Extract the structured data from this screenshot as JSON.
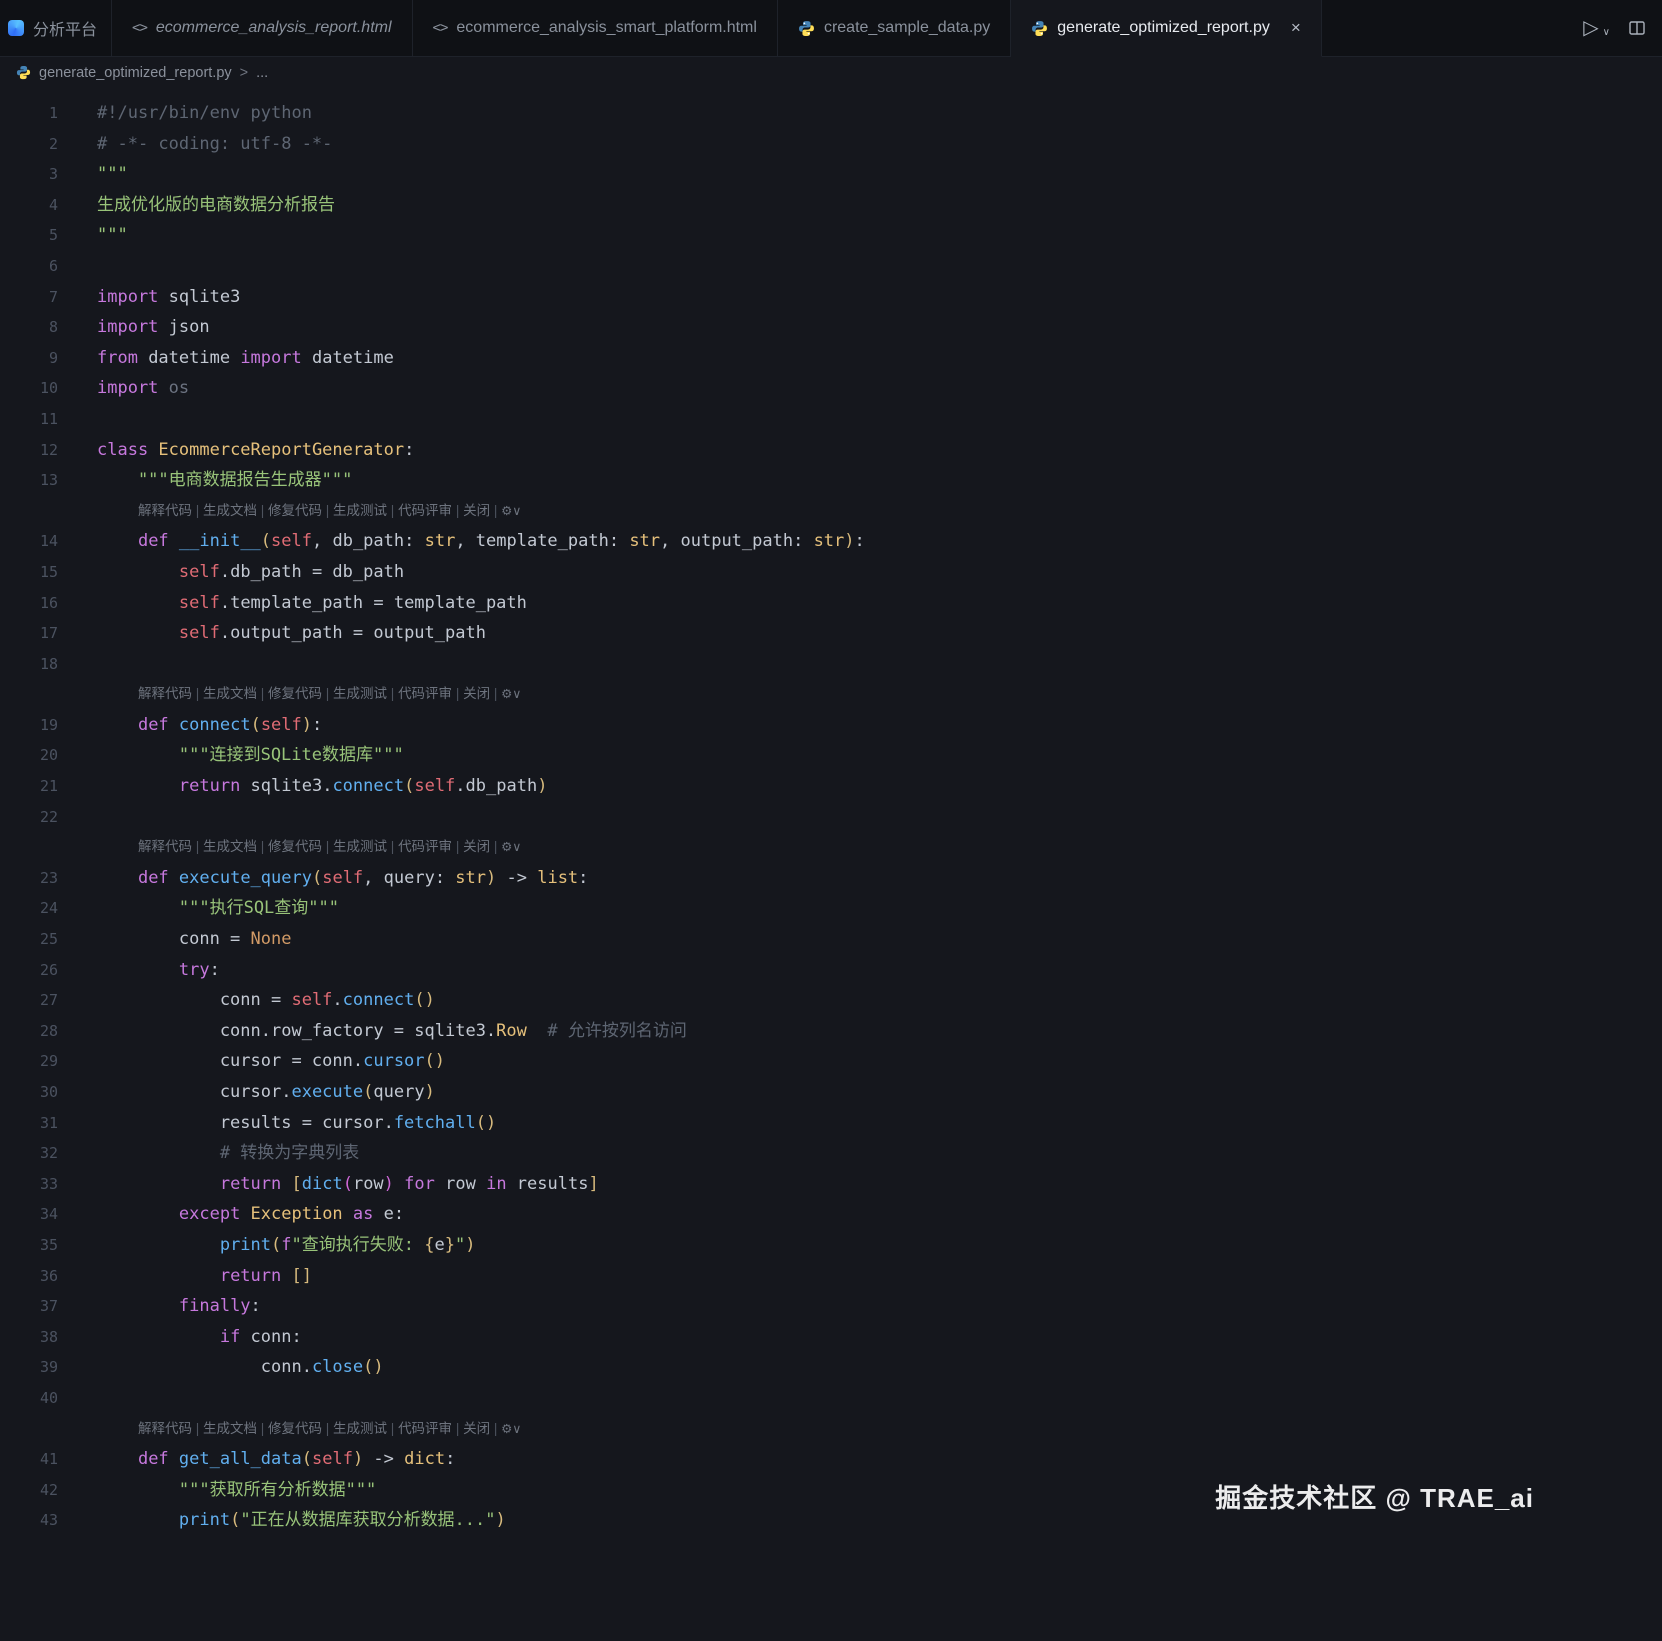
{
  "palette": {
    "background": "#15171d",
    "tabbar": "#0f1115",
    "border": "#1e222a",
    "tab_text": "#8a919c",
    "tab_active_text": "#e7eaef",
    "gutter": "#4b5260",
    "codelens": "#6d737e",
    "text": "#c3c9d3",
    "keyword": "#c678dd",
    "function": "#61afef",
    "type": "#e5c07b",
    "string": "#98c379",
    "comment": "#5e6673",
    "self": "#e06c75",
    "constant": "#d19a66",
    "bracket1": "#d7ba7d",
    "bracket2": "#cf68d8",
    "dim": "#6b7280"
  },
  "icons": {
    "html": "<>"
  },
  "tab_bar": {
    "tabs": [
      {
        "label": "分析平台",
        "icon": "app"
      },
      {
        "label": "ecommerce_analysis_report.html",
        "icon": "html",
        "italic": true
      },
      {
        "label": "ecommerce_analysis_smart_platform.html",
        "icon": "html"
      },
      {
        "label": "create_sample_data.py",
        "icon": "python"
      },
      {
        "label": "generate_optimized_report.py",
        "icon": "python",
        "active": true,
        "close": "×"
      }
    ],
    "actions": {
      "run": "▷",
      "dropdown": "∨"
    }
  },
  "breadcrumb": {
    "file": "generate_optimized_report.py",
    "chevron": ">",
    "more": "..."
  },
  "editor": {
    "codelens": {
      "items": [
        "解释代码",
        "生成文档",
        "修复代码",
        "生成测试",
        "代码评审",
        "关闭"
      ],
      "sep": " | ",
      "icon": "⚙",
      "chevron": "∨"
    },
    "rows": [
      {
        "n": "1",
        "t": [
          [
            "c",
            "#!/usr/bin/env python"
          ]
        ]
      },
      {
        "n": "2",
        "t": [
          [
            "c",
            "# -*- coding: utf-8 -*-"
          ]
        ]
      },
      {
        "n": "3",
        "t": [
          [
            "s",
            "\"\"\""
          ]
        ]
      },
      {
        "n": "4",
        "t": [
          [
            "s",
            "生成优化版的电商数据分析报告"
          ]
        ]
      },
      {
        "n": "5",
        "t": [
          [
            "s",
            "\"\"\""
          ]
        ]
      },
      {
        "n": "6",
        "t": []
      },
      {
        "n": "7",
        "t": [
          [
            "k",
            "import"
          ],
          [
            "v",
            " sqlite3"
          ]
        ]
      },
      {
        "n": "8",
        "t": [
          [
            "k",
            "import"
          ],
          [
            "v",
            " json"
          ]
        ]
      },
      {
        "n": "9",
        "t": [
          [
            "k",
            "from"
          ],
          [
            "v",
            " datetime "
          ],
          [
            "k",
            "import"
          ],
          [
            "v",
            " datetime"
          ]
        ]
      },
      {
        "n": "10",
        "t": [
          [
            "k",
            "import"
          ],
          [
            "dim",
            " os"
          ]
        ]
      },
      {
        "n": "11",
        "t": []
      },
      {
        "n": "12",
        "t": [
          [
            "k",
            "class"
          ],
          [
            "cls",
            " EcommerceReportGenerator"
          ],
          [
            "v",
            ":"
          ]
        ]
      },
      {
        "n": "13",
        "t": [
          [
            "s",
            "    \"\"\"电商数据报告生成器\"\"\""
          ]
        ]
      },
      {
        "lens": true
      },
      {
        "n": "14",
        "t": [
          [
            "v",
            "    "
          ],
          [
            "k",
            "def"
          ],
          [
            "fn",
            " __init__"
          ],
          [
            "b1",
            "("
          ],
          [
            "sf",
            "self"
          ],
          [
            "v",
            ", db_path: "
          ],
          [
            "cls",
            "str"
          ],
          [
            "v",
            ", template_path: "
          ],
          [
            "cls",
            "str"
          ],
          [
            "v",
            ", output_path: "
          ],
          [
            "cls",
            "str"
          ],
          [
            "b1",
            ")"
          ],
          [
            "v",
            ":"
          ]
        ]
      },
      {
        "n": "15",
        "t": [
          [
            "v",
            "        "
          ],
          [
            "sf",
            "self"
          ],
          [
            "v",
            ".db_path = db_path"
          ]
        ]
      },
      {
        "n": "16",
        "t": [
          [
            "v",
            "        "
          ],
          [
            "sf",
            "self"
          ],
          [
            "v",
            ".template_path = template_path"
          ]
        ]
      },
      {
        "n": "17",
        "t": [
          [
            "v",
            "        "
          ],
          [
            "sf",
            "self"
          ],
          [
            "v",
            ".output_path = output_path"
          ]
        ]
      },
      {
        "n": "18",
        "t": []
      },
      {
        "lens": true
      },
      {
        "n": "19",
        "t": [
          [
            "v",
            "    "
          ],
          [
            "k",
            "def"
          ],
          [
            "fn",
            " connect"
          ],
          [
            "b1",
            "("
          ],
          [
            "sf",
            "self"
          ],
          [
            "b1",
            ")"
          ],
          [
            "v",
            ":"
          ]
        ]
      },
      {
        "n": "20",
        "t": [
          [
            "s",
            "        \"\"\"连接到SQLite数据库\"\"\""
          ]
        ]
      },
      {
        "n": "21",
        "t": [
          [
            "v",
            "        "
          ],
          [
            "k",
            "return"
          ],
          [
            "v",
            " sqlite3."
          ],
          [
            "fn",
            "connect"
          ],
          [
            "b1",
            "("
          ],
          [
            "sf",
            "self"
          ],
          [
            "v",
            ".db_path"
          ],
          [
            "b1",
            ")"
          ]
        ]
      },
      {
        "n": "22",
        "t": []
      },
      {
        "lens": true
      },
      {
        "n": "23",
        "t": [
          [
            "v",
            "    "
          ],
          [
            "k",
            "def"
          ],
          [
            "fn",
            " execute_query"
          ],
          [
            "b1",
            "("
          ],
          [
            "sf",
            "self"
          ],
          [
            "v",
            ", query: "
          ],
          [
            "cls",
            "str"
          ],
          [
            "b1",
            ")"
          ],
          [
            "v",
            " -> "
          ],
          [
            "cls",
            "list"
          ],
          [
            "v",
            ":"
          ]
        ]
      },
      {
        "n": "24",
        "t": [
          [
            "s",
            "        \"\"\"执行SQL查询\"\"\""
          ]
        ]
      },
      {
        "n": "25",
        "t": [
          [
            "v",
            "        conn = "
          ],
          [
            "const",
            "None"
          ]
        ]
      },
      {
        "n": "26",
        "t": [
          [
            "v",
            "        "
          ],
          [
            "k",
            "try"
          ],
          [
            "v",
            ":"
          ]
        ]
      },
      {
        "n": "27",
        "t": [
          [
            "v",
            "            conn = "
          ],
          [
            "sf",
            "self"
          ],
          [
            "v",
            "."
          ],
          [
            "fn",
            "connect"
          ],
          [
            "b1",
            "()"
          ]
        ]
      },
      {
        "n": "28",
        "t": [
          [
            "v",
            "            conn.row_factory = sqlite3."
          ],
          [
            "cls",
            "Row"
          ],
          [
            "c",
            "  # 允许按列名访问"
          ]
        ]
      },
      {
        "n": "29",
        "t": [
          [
            "v",
            "            cursor = conn."
          ],
          [
            "fn",
            "cursor"
          ],
          [
            "b1",
            "()"
          ]
        ]
      },
      {
        "n": "30",
        "t": [
          [
            "v",
            "            cursor."
          ],
          [
            "fn",
            "execute"
          ],
          [
            "b1",
            "("
          ],
          [
            "v",
            "query"
          ],
          [
            "b1",
            ")"
          ]
        ]
      },
      {
        "n": "31",
        "t": [
          [
            "v",
            "            results = cursor."
          ],
          [
            "fn",
            "fetchall"
          ],
          [
            "b1",
            "()"
          ]
        ]
      },
      {
        "n": "32",
        "t": [
          [
            "c",
            "            # 转换为字典列表"
          ]
        ]
      },
      {
        "n": "33",
        "t": [
          [
            "v",
            "            "
          ],
          [
            "k",
            "return"
          ],
          [
            "v",
            " "
          ],
          [
            "b1",
            "["
          ],
          [
            "fn",
            "dict"
          ],
          [
            "b2",
            "("
          ],
          [
            "v",
            "row"
          ],
          [
            "b2",
            ")"
          ],
          [
            "v",
            " "
          ],
          [
            "k",
            "for"
          ],
          [
            "v",
            " row "
          ],
          [
            "k",
            "in"
          ],
          [
            "v",
            " results"
          ],
          [
            "b1",
            "]"
          ]
        ]
      },
      {
        "n": "34",
        "t": [
          [
            "v",
            "        "
          ],
          [
            "k",
            "except"
          ],
          [
            "cls",
            " Exception"
          ],
          [
            "k",
            " as"
          ],
          [
            "v",
            " e:"
          ]
        ]
      },
      {
        "n": "35",
        "t": [
          [
            "v",
            "            "
          ],
          [
            "fn",
            "print"
          ],
          [
            "b1",
            "("
          ],
          [
            "k",
            "f"
          ],
          [
            "s",
            "\"查询执行失败: "
          ],
          [
            "b1",
            "{"
          ],
          [
            "v",
            "e"
          ],
          [
            "b1",
            "}"
          ],
          [
            "s",
            "\""
          ],
          [
            "b1",
            ")"
          ]
        ]
      },
      {
        "n": "36",
        "t": [
          [
            "v",
            "            "
          ],
          [
            "k",
            "return"
          ],
          [
            "v",
            " "
          ],
          [
            "b1",
            "[]"
          ]
        ]
      },
      {
        "n": "37",
        "t": [
          [
            "v",
            "        "
          ],
          [
            "k",
            "finally"
          ],
          [
            "v",
            ":"
          ]
        ]
      },
      {
        "n": "38",
        "t": [
          [
            "v",
            "            "
          ],
          [
            "k",
            "if"
          ],
          [
            "v",
            " conn:"
          ]
        ]
      },
      {
        "n": "39",
        "t": [
          [
            "v",
            "                conn."
          ],
          [
            "fn",
            "close"
          ],
          [
            "b1",
            "()"
          ]
        ]
      },
      {
        "n": "40",
        "t": []
      },
      {
        "lens": true
      },
      {
        "n": "41",
        "t": [
          [
            "v",
            "    "
          ],
          [
            "k",
            "def"
          ],
          [
            "fn",
            " get_all_data"
          ],
          [
            "b1",
            "("
          ],
          [
            "sf",
            "self"
          ],
          [
            "b1",
            ")"
          ],
          [
            "v",
            " -> "
          ],
          [
            "cls",
            "dict"
          ],
          [
            "v",
            ":"
          ]
        ]
      },
      {
        "n": "42",
        "t": [
          [
            "s",
            "        \"\"\"获取所有分析数据\"\"\""
          ]
        ]
      },
      {
        "n": "43",
        "t": [
          [
            "v",
            "        "
          ],
          [
            "fn",
            "print"
          ],
          [
            "b1",
            "("
          ],
          [
            "s",
            "\"正在从数据库获取分析数据...\""
          ],
          [
            "b1",
            ")"
          ]
        ]
      }
    ]
  },
  "watermark": {
    "text": "掘金技术社区 @ TRAE_ai"
  }
}
